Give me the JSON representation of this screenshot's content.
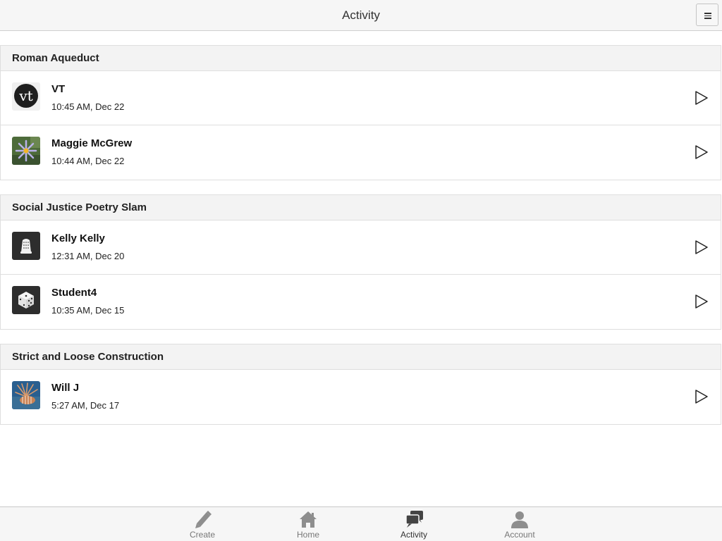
{
  "header": {
    "title": "Activity",
    "menu_icon": "hamburger-menu-icon"
  },
  "groups": [
    {
      "title": "Roman Aqueduct",
      "items": [
        {
          "name": "VT",
          "time": "10:45 AM, Dec 22",
          "avatar": "vt-logo"
        },
        {
          "name": "Maggie McGrew",
          "time": "10:44 AM, Dec 22",
          "avatar": "flower-photo"
        }
      ]
    },
    {
      "title": "Social Justice Poetry Slam",
      "items": [
        {
          "name": "Kelly Kelly",
          "time": "12:31 AM, Dec 20",
          "avatar": "thimble-icon"
        },
        {
          "name": "Student4",
          "time": "10:35 AM, Dec 15",
          "avatar": "dice-icon"
        }
      ]
    },
    {
      "title": "Strict and Loose Construction",
      "items": [
        {
          "name": "Will J",
          "time": "5:27 AM, Dec 17",
          "avatar": "lionfish-photo"
        }
      ]
    }
  ],
  "avatar_text": {
    "vt": "vt"
  },
  "tabbar": {
    "tabs": [
      {
        "label": "Create",
        "icon": "pencil-icon",
        "active": false
      },
      {
        "label": "Home",
        "icon": "home-icon",
        "active": false
      },
      {
        "label": "Activity",
        "icon": "chat-bubbles-icon",
        "active": true
      },
      {
        "label": "Account",
        "icon": "person-icon",
        "active": false
      }
    ]
  },
  "colors": {
    "header_bg": "#f6f6f6",
    "group_header_bg": "#f3f3f3",
    "border": "#dedede",
    "tab_inactive": "#777777",
    "tab_active": "#333333"
  }
}
